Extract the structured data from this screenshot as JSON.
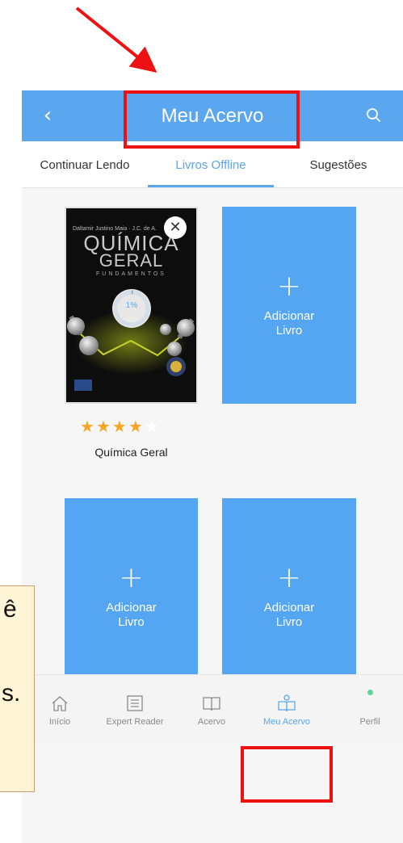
{
  "appbar": {
    "back_icon": "chevron-left-icon",
    "title": "Meu Acervo",
    "search_icon": "search-icon"
  },
  "tabs": [
    {
      "label": "Continuar Lendo",
      "active": false
    },
    {
      "label": "Livros Offline",
      "active": true
    },
    {
      "label": "Sugestões",
      "active": false
    }
  ],
  "book": {
    "cover_author": "Daltamir Justino Maia · J.C. de A.",
    "cover_title_line1": "QUÍMICA",
    "cover_title_line2": "GERAL",
    "cover_subtitle": "FUNDAMENTOS",
    "download_progress": "1%",
    "rating": 4,
    "rating_max": 5,
    "title": "Química Geral"
  },
  "add_card": {
    "plus": "+",
    "label_line1": "Adicionar",
    "label_line2": "Livro"
  },
  "nav": [
    {
      "label": "Início",
      "icon": "home-icon",
      "active": false
    },
    {
      "label": "Expert Reader",
      "icon": "list-icon",
      "active": false
    },
    {
      "label": "Acervo",
      "icon": "book-open-icon",
      "active": false
    },
    {
      "label": "Meu Acervo",
      "icon": "reader-icon",
      "active": true
    },
    {
      "label": "Perfil",
      "icon": "status-dot-icon",
      "active": false
    }
  ],
  "callout_chars": [
    "ê",
    "s."
  ],
  "colors": {
    "primary": "#5aa6ef",
    "card": "#55a6f2",
    "star": "#f5a623",
    "annotation": "#ee1111",
    "online_dot": "#5fd39a"
  }
}
